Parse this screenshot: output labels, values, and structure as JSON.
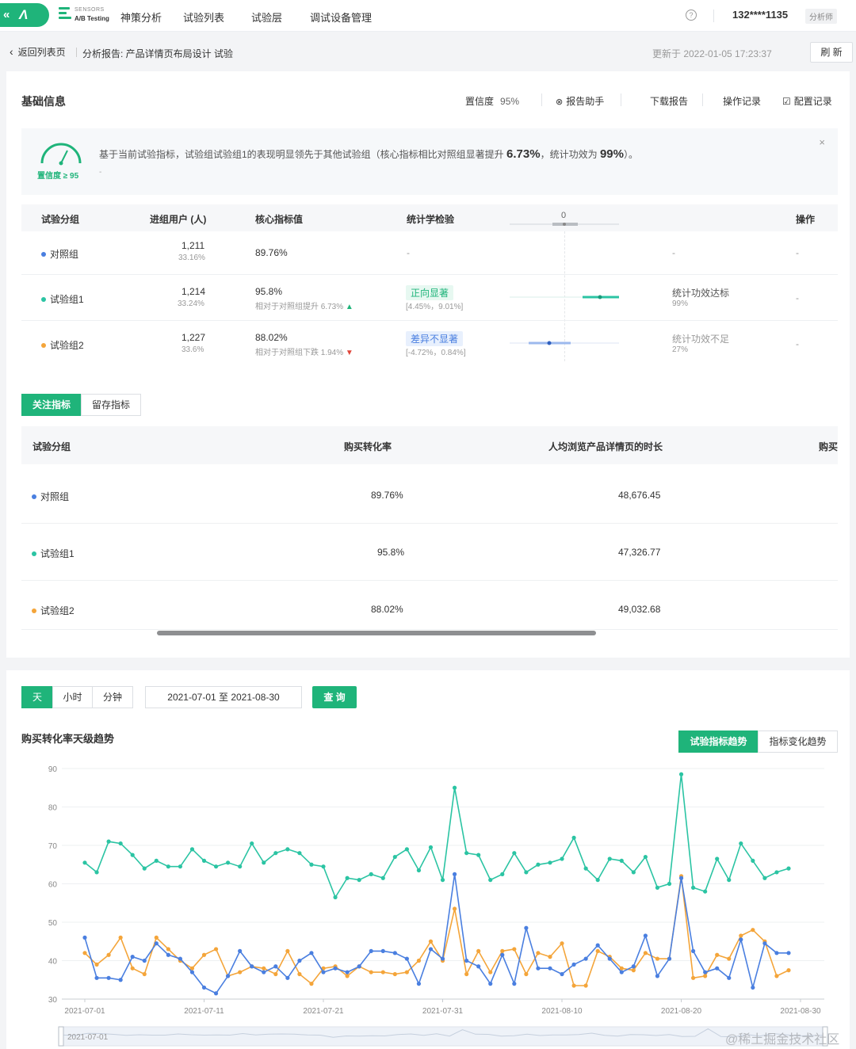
{
  "topnav": {
    "brand_top": "SENSORS",
    "brand_bottom": "A/B Testing",
    "items": [
      "神策分析",
      "试验列表",
      "试验层",
      "调试设备管理"
    ],
    "help": "?",
    "user_id": "132****1135",
    "role": "分析师"
  },
  "breadcrumb": {
    "back_label": "返回列表页",
    "title": "分析报告: 产品详情页布局设计 试验",
    "updated": "更新于 2022-01-05 17:23:37",
    "refresh_label": "刷 新"
  },
  "basic": {
    "title": "基础信息",
    "confidence_label": "置信度",
    "confidence_value": "95%",
    "report_helper": "报告助手",
    "download": "下载报告",
    "op_log": "操作记录",
    "config_log": "配置记录"
  },
  "alert": {
    "gauge_label": "置信度 ≥ 95",
    "msg_prefix": "基于当前试验指标，试验组试验组1的表现明显领先于其他试验组（核心指标相比对照组显著提升",
    "lift": "6.73%",
    "msg_mid": "，统计功效为",
    "power": "99%",
    "msg_suffix": "）。",
    "dash": "-",
    "close": "×"
  },
  "summary_table": {
    "headers": [
      "试验分组",
      "进组用户 (人)",
      "核心指标值",
      "统计学检验",
      "0",
      "操作"
    ],
    "rows": [
      {
        "group": "对照组",
        "color": "#4a7fe0",
        "users": "1,211",
        "pct": "33.16%",
        "metric": "89.76%",
        "metric_sub": "",
        "stat": "-",
        "stat_range": "",
        "power": "-",
        "power_sub": "",
        "op": "-"
      },
      {
        "group": "试验组1",
        "color": "#2bc4a3",
        "users": "1,214",
        "pct": "33.24%",
        "metric": "95.8%",
        "metric_sub": "相对于对照组提升 6.73%",
        "arrow": "▲",
        "stat": "正向显著",
        "stat_range": "[4.45%，9.01%]",
        "power": "统计功效达标",
        "power_sub": "99%",
        "op": "-"
      },
      {
        "group": "试验组2",
        "color": "#f4a53a",
        "users": "1,227",
        "pct": "33.6%",
        "metric": "88.02%",
        "metric_sub": "相对于对照组下跌 1.94%",
        "arrow": "▼",
        "stat": "差异不显著",
        "stat_range": "[-4.72%，0.84%]",
        "power": "统计功效不足",
        "power_sub": "27%",
        "op": "-"
      }
    ]
  },
  "metric_tabs": [
    "关注指标",
    "留存指标"
  ],
  "metric_table": {
    "headers": [
      "试验分组",
      "购买转化率",
      "人均浏览产品详情页的时长",
      "购买"
    ],
    "rows": [
      {
        "group": "对照组",
        "color": "#4a7fe0",
        "conv": "89.76%",
        "dur": "48,676.45"
      },
      {
        "group": "试验组1",
        "color": "#2bc4a3",
        "conv": "95.8%",
        "dur": "47,326.77"
      },
      {
        "group": "试验组2",
        "color": "#f4a53a",
        "conv": "88.02%",
        "dur": "49,032.68"
      }
    ]
  },
  "granularity": [
    "天",
    "小时",
    "分钟"
  ],
  "date_range": "2021-07-01 至 2021-08-30",
  "query_label": "查 询",
  "trend": {
    "title": "购买转化率天级趋势",
    "tabs": [
      "试验指标趋势",
      "指标变化趋势"
    ]
  },
  "chart_data": {
    "type": "line",
    "title": "购买转化率天级趋势",
    "ylim": [
      30,
      90
    ],
    "yticks": [
      90,
      80,
      70,
      60,
      50,
      40,
      30
    ],
    "xtick_labels": [
      "2021-07-01",
      "2021-07-11",
      "2021-07-21",
      "2021-07-31",
      "2021-08-10",
      "2021-08-20",
      "2021-08-30"
    ],
    "x_start": "2021-07-01",
    "x_end": "2021-08-30",
    "grid": true,
    "slider_label": "2021-07-01",
    "series": [
      {
        "color": "#2bc4a3",
        "values": [
          65.5,
          63,
          71,
          70.5,
          67.5,
          64,
          66,
          64.5,
          64.5,
          69,
          66,
          64.5,
          65.5,
          64.5,
          70.5,
          65.5,
          68,
          69,
          68,
          65,
          64.5,
          56.5,
          61.5,
          61,
          62.5,
          61.5,
          67,
          69,
          63.5,
          69.5,
          61,
          85,
          68,
          67.5,
          61,
          62.5,
          68,
          63,
          65,
          65.5,
          66.5,
          72,
          64,
          61,
          66.5,
          66,
          63,
          67,
          59,
          60,
          88.5,
          59,
          58,
          66.5,
          61,
          70.5,
          66,
          61.5,
          63,
          64
        ]
      },
      {
        "color": "#4a7fe0",
        "values": [
          46,
          35.5,
          35.5,
          35,
          41,
          40,
          44.5,
          41.5,
          40.5,
          37,
          33,
          31.5,
          36,
          42.5,
          38.5,
          37,
          38.5,
          35.5,
          40,
          42,
          37,
          38,
          37,
          38.5,
          42.5,
          42.5,
          42,
          40.5,
          34,
          43,
          40.5,
          62.5,
          40,
          38.5,
          34,
          41.5,
          34,
          48.5,
          38,
          38,
          36.5,
          39,
          40.5,
          44,
          40.5,
          37,
          38.5,
          46.5,
          36,
          40.5,
          61.5,
          42.5,
          37,
          38,
          35.5,
          45.5,
          33,
          44.5,
          42,
          42
        ]
      },
      {
        "color": "#f4a53a",
        "values": [
          42,
          39,
          41.5,
          46,
          38,
          36.5,
          46,
          43,
          40,
          38,
          41.5,
          43,
          36,
          37,
          38.5,
          38,
          36.5,
          42.5,
          36.5,
          34,
          38,
          38.5,
          36,
          38.5,
          37,
          37,
          36.5,
          37,
          40,
          45,
          40,
          53.5,
          36.5,
          42.5,
          37,
          42.5,
          43,
          36.5,
          42,
          41,
          44.5,
          33.5,
          33.5,
          42.5,
          41,
          38,
          37.5,
          42,
          40.5,
          40.5,
          62,
          35.5,
          36,
          41.5,
          40.5,
          46.5,
          48,
          45,
          36,
          37.5
        ]
      }
    ]
  },
  "watermark": "@稀土掘金技术社区"
}
